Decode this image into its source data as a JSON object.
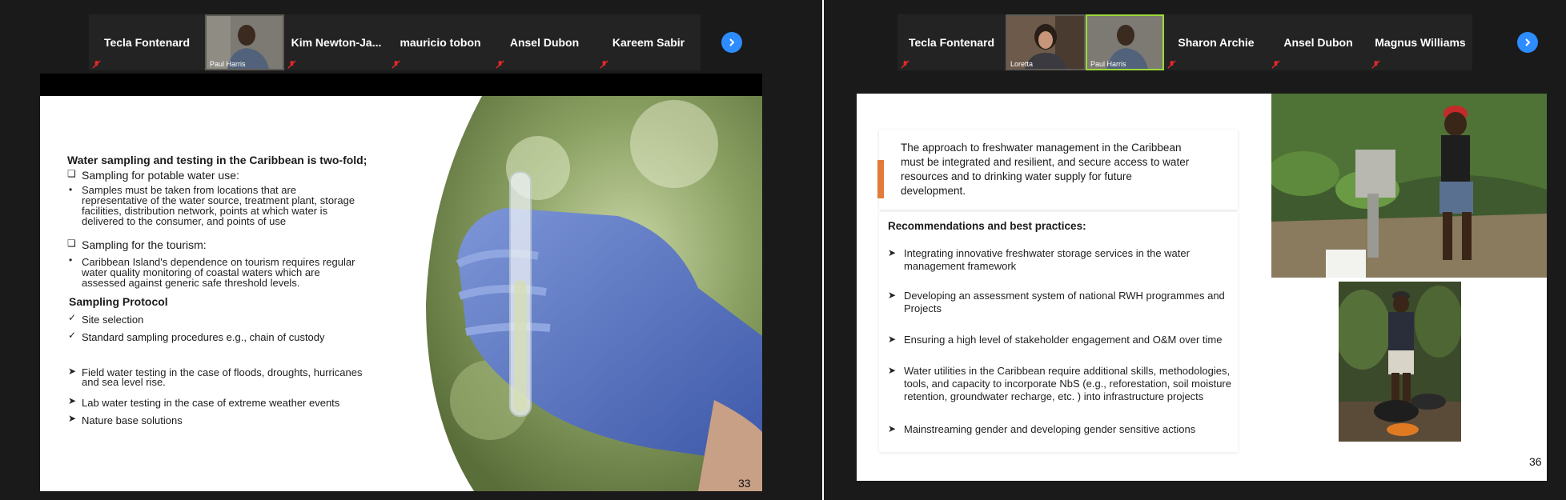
{
  "left": {
    "participants": [
      {
        "name": "Tecla Fontenard",
        "video": false
      },
      {
        "name": "Paul Harris",
        "video": true
      },
      {
        "name": "Kim  Newton-Ja...",
        "video": false
      },
      {
        "name": "mauricio tobon",
        "video": false
      },
      {
        "name": "Ansel Dubon",
        "video": false
      },
      {
        "name": "Kareem Sabir",
        "video": false
      }
    ],
    "slide": {
      "heading": "Water sampling and testing in the Caribbean is two-fold;",
      "item1": "Sampling  for potable  water use:",
      "bullet1": [
        "Samples  must  be  taken from locations  that are",
        "representative of the water source, treatment plant, storage",
        "facilities, distribution  network, points at which  water is",
        "delivered to the consumer, and points of use"
      ],
      "item2": "Sampling for the tourism:",
      "bullet2": [
        "Caribbean Island's dependence  on tourism  requires regular",
        "water quality monitoring  of coastal waters which  are",
        "assessed  against generic safe threshold levels."
      ],
      "protocol_heading": "Sampling Protocol",
      "checks": [
        "Site selection",
        "Standard sampling procedures e.g., chain of custody"
      ],
      "arrows": [
        [
          "Field water testing in the case of floods,  droughts, hurricanes",
          "and sea level rise."
        ],
        [
          "Lab water testing in the case of extreme weather events"
        ],
        [
          "Nature base solutions"
        ]
      ],
      "page": "33"
    }
  },
  "right": {
    "participants": [
      {
        "name": "Tecla Fontenard",
        "video": false
      },
      {
        "name": "Loretta",
        "video": true
      },
      {
        "name": "Paul Harris",
        "video": true
      },
      {
        "name": "Sharon Archie",
        "video": false
      },
      {
        "name": "Ansel Dubon",
        "video": false
      },
      {
        "name": "Magnus Williams",
        "video": false
      }
    ],
    "slide": {
      "intro": [
        "The approach to freshwater management in the Caribbean",
        "must be integrated and resilient, and secure access to water",
        "resources and to drinking water supply for future",
        "development."
      ],
      "rec_heading": "Recommendations and best practices:",
      "recs": [
        [
          "Integrating innovative freshwater storage services in the water",
          "management framework"
        ],
        [
          "Developing an assessment system of national RWH programmes and",
          "Projects"
        ],
        [
          "Ensuring a high level of stakeholder engagement and O&M over time"
        ],
        [
          "Water utilities in the Caribbean require additional skills, methodologies,",
          "tools, and capacity to incorporate NbS (e.g., reforestation, soil moisture",
          "retention, groundwater recharge, etc. ) into infrastructure projects"
        ],
        [
          "Mainstreaming gender and developing gender sensitive actions"
        ]
      ],
      "page": "36"
    }
  }
}
